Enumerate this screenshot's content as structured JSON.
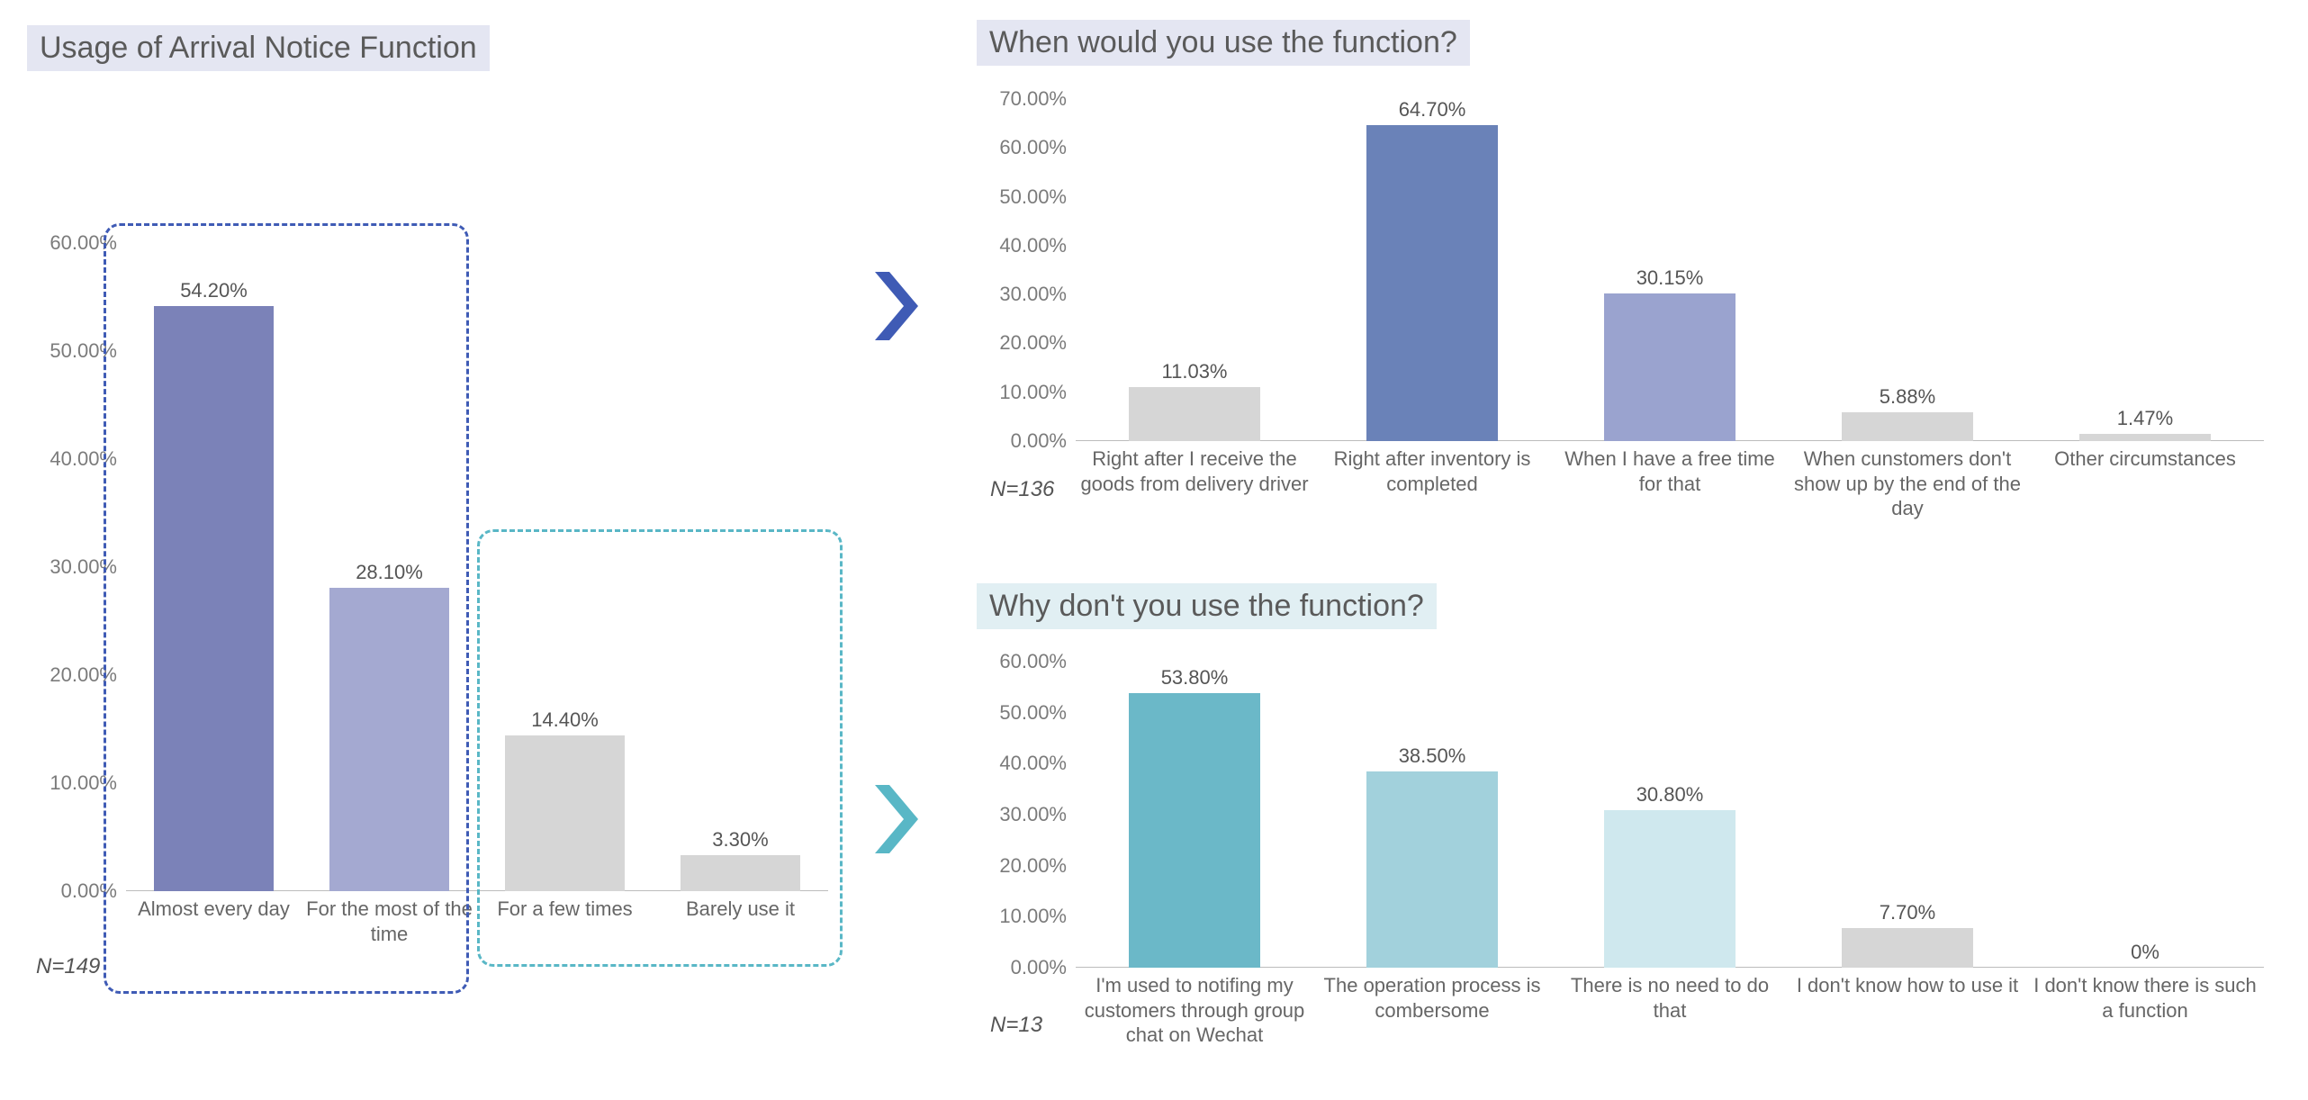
{
  "titles": {
    "main": "Usage of Arrival Notice Function",
    "upper": "When would you use the function?",
    "lower": "Why don't you use the function?"
  },
  "sample_labels": {
    "main": "N=149",
    "upper": "N=136",
    "lower": "N=13"
  },
  "annotation_colors": {
    "group_high_border": "#3f5bb5",
    "group_low_border": "#59b7c6",
    "arrow_high": "#3f5bb5",
    "arrow_low": "#59b7c6"
  },
  "chart_data": [
    {
      "id": "usage",
      "title": "Usage of Arrival Notice Function",
      "type": "bar",
      "sample_size": 149,
      "ylim": [
        0,
        60
      ],
      "ystep": 10,
      "ylabel_fmt": "pct2",
      "categories": [
        "Almost every day",
        "For the most of the time",
        "For a few times",
        "Barely use it"
      ],
      "label_fmt": [
        "54.20%",
        "28.10%",
        "14.40%",
        "3.30%"
      ],
      "values": [
        54.2,
        28.1,
        14.4,
        3.3
      ],
      "colors": [
        "#7b82b8",
        "#a4a9d1",
        "#d6d6d6",
        "#d6d6d6"
      ],
      "groups": [
        {
          "name": "frequent",
          "indices": [
            0,
            1
          ],
          "links_to": "when"
        },
        {
          "name": "infrequent",
          "indices": [
            2,
            3
          ],
          "links_to": "whynot"
        }
      ]
    },
    {
      "id": "when",
      "title": "When would you use the function?",
      "type": "bar",
      "sample_size": 136,
      "ylim": [
        0,
        70
      ],
      "ystep": 10,
      "ylabel_fmt": "pct2",
      "categories": [
        "Right after I receive the goods from delivery driver",
        "Right after inventory is completed",
        "When I have a free time for that",
        "When cunstomers don't show up by the end of the day",
        "Other circumstances"
      ],
      "label_fmt": [
        "11.03%",
        "64.70%",
        "30.15%",
        "5.88%",
        "1.47%"
      ],
      "values": [
        11.03,
        64.7,
        30.15,
        5.88,
        1.47
      ],
      "colors": [
        "#d6d6d6",
        "#6a82b8",
        "#9aa3cf",
        "#d6d6d6",
        "#d6d6d6"
      ]
    },
    {
      "id": "whynot",
      "title": "Why don't you use the function?",
      "type": "bar",
      "sample_size": 13,
      "ylim": [
        0,
        60
      ],
      "ystep": 10,
      "ylabel_fmt": "pct2",
      "categories": [
        "I'm used to notifing my customers through group chat on Wechat",
        "The operation process is combersome",
        "There is no need to do that",
        "I don't know how to use it",
        "I don't know there is such a function"
      ],
      "label_fmt": [
        "53.80%",
        "38.50%",
        "30.80%",
        "7.70%",
        "0%"
      ],
      "values": [
        53.8,
        38.5,
        30.8,
        7.7,
        0.0
      ],
      "colors": [
        "#6bb8c8",
        "#a2d1dc",
        "#cfe8ee",
        "#d6d6d6",
        "#d6d6d6"
      ]
    }
  ]
}
